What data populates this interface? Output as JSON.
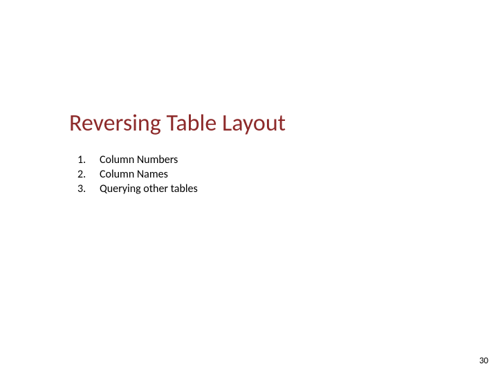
{
  "slide": {
    "title": "Reversing Table Layout",
    "items": [
      {
        "num": "1.",
        "text": "Column Numbers"
      },
      {
        "num": "2.",
        "text": "Column Names"
      },
      {
        "num": "3.",
        "text": "Querying other tables"
      }
    ],
    "page_number": "30"
  }
}
